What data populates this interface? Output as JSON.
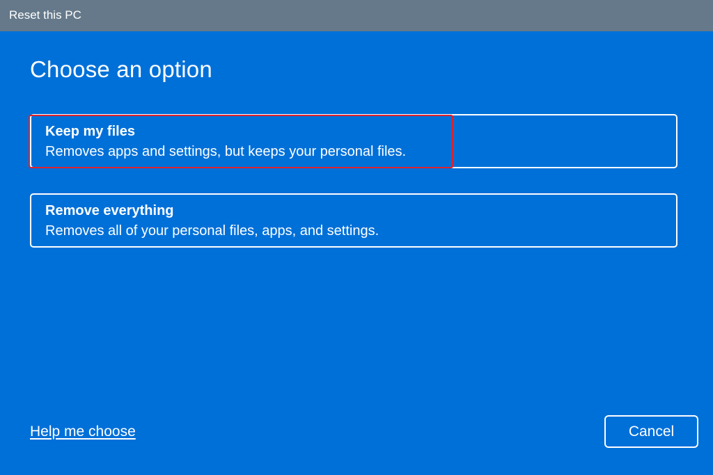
{
  "window": {
    "title": "Reset this PC"
  },
  "main": {
    "heading": "Choose an option",
    "options": [
      {
        "title": "Keep my files",
        "description": "Removes apps and settings, but keeps your personal files.",
        "highlighted": true
      },
      {
        "title": "Remove everything",
        "description": "Removes all of your personal files, apps, and settings.",
        "highlighted": false
      }
    ]
  },
  "footer": {
    "help_link": "Help me choose",
    "cancel_label": "Cancel"
  },
  "colors": {
    "titlebar": "#65798a",
    "background": "#0070d9",
    "highlight": "#e0212b",
    "text": "#ffffff"
  }
}
